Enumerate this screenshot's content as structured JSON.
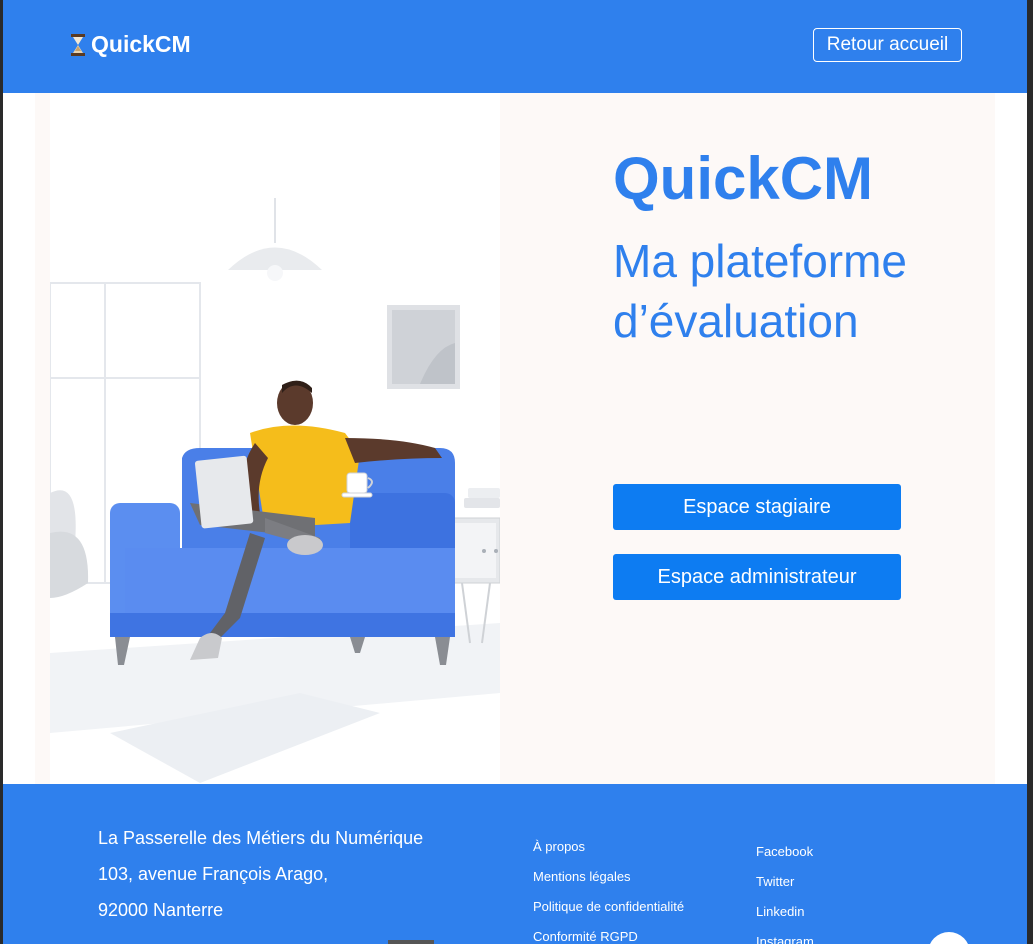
{
  "header": {
    "brand": "QuickCM",
    "home_button": "Retour accueil"
  },
  "hero": {
    "title": "QuickCM",
    "subtitle": "Ma plateforme d’évaluation"
  },
  "actions": {
    "trainee": "Espace stagiaire",
    "admin": "Espace administrateur"
  },
  "footer": {
    "address": [
      "La Passerelle des Métiers du Numérique",
      "103, avenue François Arago,",
      "92000 Nanterre"
    ],
    "links_col1": [
      "À propos",
      "Mentions légales",
      "Politique de confidentialité",
      "Conformité RGPD"
    ],
    "links_col2": [
      "Facebook",
      "Twitter",
      "Linkedin",
      "Instagram"
    ]
  },
  "colors": {
    "primary": "#2f80ed",
    "button": "#0d7cf2",
    "panel": "#fdf9f7"
  },
  "icons": {
    "brand": "hourglass-icon",
    "illustration": "man-on-sofa-illustration",
    "chat": "chat-bubble-icon"
  }
}
